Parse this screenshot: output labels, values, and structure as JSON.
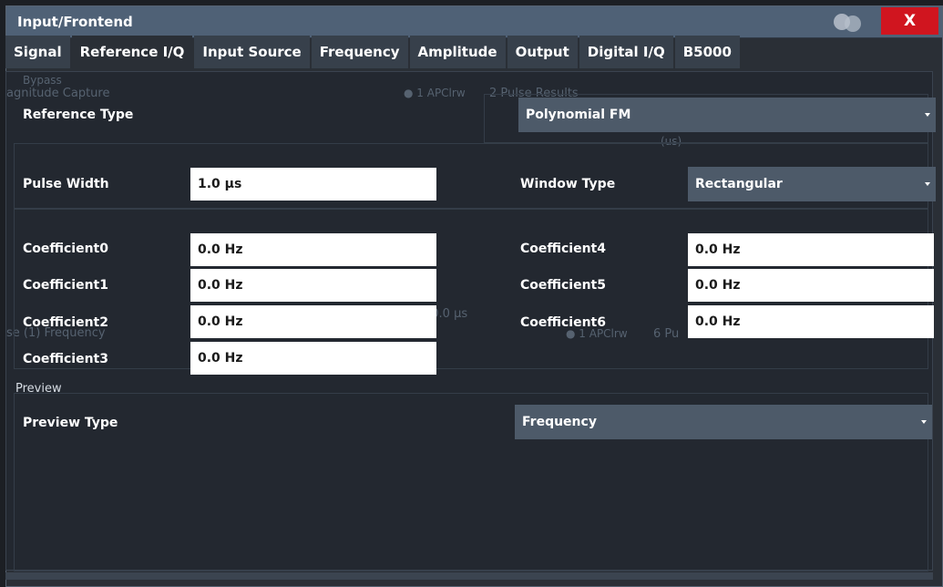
{
  "window": {
    "title": "Input/Frontend",
    "close_label": "X"
  },
  "tabs": [
    {
      "label": "Signal",
      "active": false
    },
    {
      "label": "Reference I/Q",
      "active": true
    },
    {
      "label": "Input Source",
      "active": false
    },
    {
      "label": "Frequency",
      "active": false
    },
    {
      "label": "Amplitude",
      "active": false
    },
    {
      "label": "Output",
      "active": false
    },
    {
      "label": "Digital I/Q",
      "active": false
    },
    {
      "label": "B5000",
      "active": false
    }
  ],
  "reference": {
    "type_label": "Reference Type",
    "type_value": "Polynomial FM"
  },
  "pulse": {
    "width_label": "Pulse Width",
    "width_value": "1.0 µs"
  },
  "window_type": {
    "label": "Window Type",
    "value": "Rectangular"
  },
  "coefficients": [
    {
      "label": "Coefficient0",
      "value": "0.0 Hz"
    },
    {
      "label": "Coefficient1",
      "value": "0.0 Hz"
    },
    {
      "label": "Coefficient2",
      "value": "0.0 Hz"
    },
    {
      "label": "Coefficient3",
      "value": "0.0 Hz"
    },
    {
      "label": "Coefficient4",
      "value": "0.0 Hz"
    },
    {
      "label": "Coefficient5",
      "value": "0.0 Hz"
    },
    {
      "label": "Coefficient6",
      "value": "0.0 Hz"
    }
  ],
  "preview": {
    "section_title": "Preview",
    "type_label": "Preview Type",
    "type_value": "Frequency"
  },
  "background": {
    "bypass": "Bypass",
    "magnitude_capture": "agnitude Capture",
    "apclrw_1": "● 1 APClrw",
    "pulse_results": "2 Pulse Results",
    "units": "(us)",
    "pulse_frequency": "se (1) Frequency",
    "apclrw_2": "● 1 APClrw",
    "pulse_6": "6 Pu",
    "time_marker": "50.0 µs"
  },
  "colors": {
    "titlebar": "#4f6176",
    "close": "#d0151f",
    "dropdown": "#4d5a69",
    "background": "#232830"
  }
}
